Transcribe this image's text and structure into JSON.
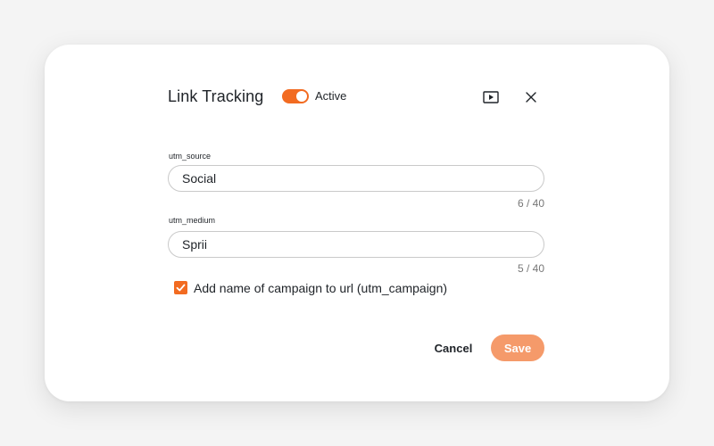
{
  "dialog": {
    "title": "Link Tracking",
    "toggle": {
      "label": "Active",
      "on": true
    },
    "icons": {
      "play": "play-icon",
      "close": "close-icon"
    }
  },
  "fields": [
    {
      "label": "utm_source",
      "value": "Social",
      "counter": "6 / 40"
    },
    {
      "label": "utm_medium",
      "value": "Sprii",
      "counter": "5 / 40"
    }
  ],
  "checkbox": {
    "label": "Add name of campaign to url (utm_campaign)",
    "checked": true
  },
  "actions": {
    "cancel": "Cancel",
    "save": "Save"
  },
  "colors": {
    "accent": "#f26b21",
    "save_button": "#f59a6a",
    "background": "#f4f4f4",
    "panel": "#ffffff"
  }
}
